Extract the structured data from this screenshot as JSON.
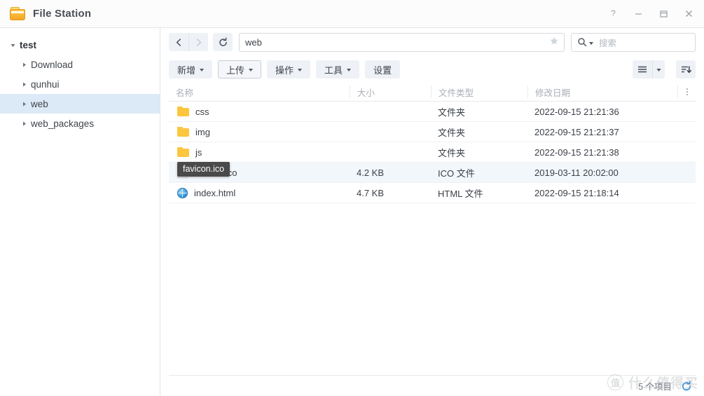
{
  "window": {
    "title": "File Station",
    "app_icon": "folder-icon",
    "controls": [
      {
        "name": "help-button",
        "glyph": "?"
      },
      {
        "name": "minimize-button",
        "glyph": "–"
      },
      {
        "name": "maximize-button",
        "glyph": "▭"
      },
      {
        "name": "close-button",
        "glyph": "✕"
      }
    ]
  },
  "sidebar": {
    "items": [
      {
        "label": "test",
        "level": 0,
        "expanded": true,
        "selected": false
      },
      {
        "label": "Download",
        "level": 1,
        "expanded": false,
        "selected": false
      },
      {
        "label": "qunhui",
        "level": 1,
        "expanded": false,
        "selected": false
      },
      {
        "label": "web",
        "level": 1,
        "expanded": false,
        "selected": true
      },
      {
        "label": "web_packages",
        "level": 1,
        "expanded": false,
        "selected": false
      }
    ]
  },
  "nav": {
    "back_icon": "chevron-left-icon",
    "forward_icon": "chevron-right-icon",
    "reload_icon": "reload-icon",
    "path_value": "web",
    "favorite_icon": "star-icon",
    "search_icon": "search-icon",
    "search_placeholder": "搜索",
    "search_value": ""
  },
  "toolbar": {
    "buttons": [
      {
        "label": "新增",
        "caret": true,
        "outlined": false,
        "name": "create-button"
      },
      {
        "label": "上传",
        "caret": true,
        "outlined": true,
        "name": "upload-button"
      },
      {
        "label": "操作",
        "caret": true,
        "outlined": false,
        "name": "action-button"
      },
      {
        "label": "工具",
        "caret": true,
        "outlined": false,
        "name": "tools-button"
      },
      {
        "label": "设置",
        "caret": false,
        "outlined": false,
        "name": "settings-button"
      }
    ],
    "view_icon": "list-view-icon",
    "view_caret_icon": "chevron-down-icon",
    "sort_icon": "sort-descending-icon"
  },
  "file_list": {
    "columns": [
      {
        "label": "名称",
        "key": "name"
      },
      {
        "label": "大小",
        "key": "size"
      },
      {
        "label": "文件类型",
        "key": "type"
      },
      {
        "label": "修改日期",
        "key": "date"
      }
    ],
    "column_menu_icon": "more-vertical-icon",
    "rows": [
      {
        "name": "css",
        "size": "",
        "type": "文件夹",
        "date": "2022-09-15 21:21:36",
        "icon": "folder-icon",
        "highlighted": false
      },
      {
        "name": "img",
        "size": "",
        "type": "文件夹",
        "date": "2022-09-15 21:21:37",
        "icon": "folder-icon",
        "highlighted": false
      },
      {
        "name": "js",
        "size": "",
        "type": "文件夹",
        "date": "2022-09-15 21:21:38",
        "icon": "folder-icon",
        "highlighted": false
      },
      {
        "name": "favicon.ico",
        "size": "4.2 KB",
        "type": "ICO 文件",
        "date": "2019-03-11 20:02:00",
        "icon": "image-file-icon",
        "highlighted": true
      },
      {
        "name": "index.html",
        "size": "4.7 KB",
        "type": "HTML 文件",
        "date": "2022-09-15 21:18:14",
        "icon": "html-file-icon",
        "highlighted": false
      }
    ],
    "tooltip": "favicon.ico"
  },
  "status": {
    "count_text": "5 个项目",
    "refresh_icon": "refresh-icon"
  },
  "watermark": {
    "badge": "值",
    "text": "什么值得买"
  },
  "colors": {
    "selection": "#dce9f7",
    "row_highlight": "#f2f7fc",
    "folder": "#fcc63f",
    "accent": "#3b8fd6",
    "border": "#e3e5e8"
  }
}
